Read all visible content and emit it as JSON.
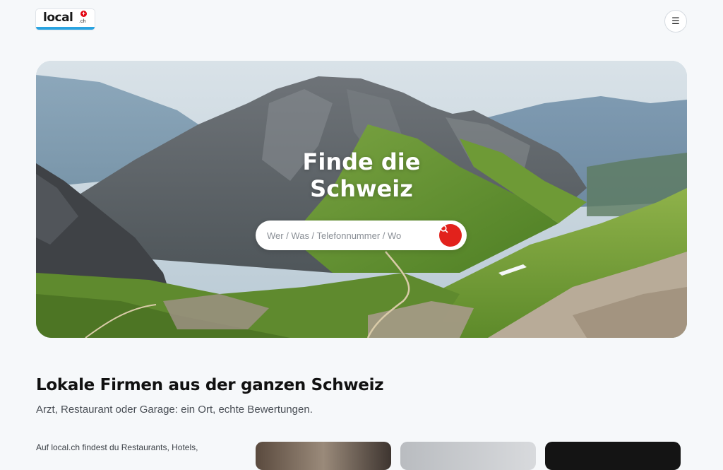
{
  "header": {
    "logo_text": "local",
    "logo_suffix": ".ch",
    "menu_icon": "menu-icon"
  },
  "hero": {
    "title_line1": "Finde die",
    "title_line2": "Schweiz",
    "search": {
      "placeholder": "Wer / Was / Telefonnummer / Wo",
      "value": "",
      "button_icon": "search-icon"
    }
  },
  "section": {
    "title": "Lokale Firmen aus der ganzen Schweiz",
    "subtitle": "Arzt, Restaurant oder Garage: ein Ort, echte Bewertungen.",
    "intro": "Auf local.ch findest du Restaurants, Hotels,"
  },
  "colors": {
    "accent": "#e2221c",
    "logo_bar": "#2aa3e0",
    "background": "#f6f8fa"
  }
}
